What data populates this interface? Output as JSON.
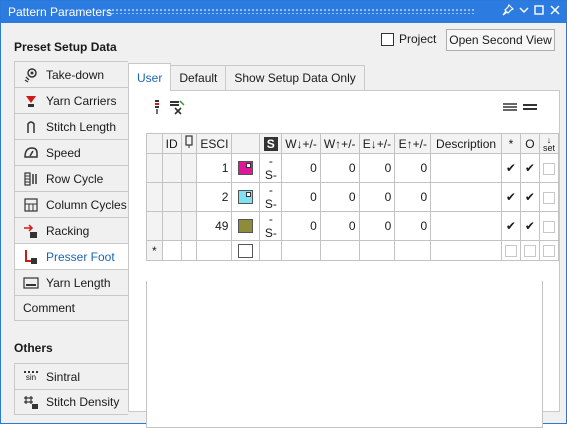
{
  "window": {
    "title": "Pattern Parameters"
  },
  "header": {
    "project_label": "Project",
    "open_second_view_label": "Open Second View"
  },
  "sidebar": {
    "preset_title": "Preset Setup Data",
    "items": [
      {
        "label": "Take-down",
        "icon": "take-down-icon"
      },
      {
        "label": "Yarn Carriers",
        "icon": "yarn-carriers-icon"
      },
      {
        "label": "Stitch Length",
        "icon": "stitch-length-icon"
      },
      {
        "label": "Speed",
        "icon": "speed-icon"
      },
      {
        "label": "Row Cycle",
        "icon": "row-cycle-icon"
      },
      {
        "label": "Column Cycles",
        "icon": "column-cycles-icon"
      },
      {
        "label": "Racking",
        "icon": "racking-icon"
      },
      {
        "label": "Presser Foot",
        "icon": "presser-foot-icon",
        "active": true
      },
      {
        "label": "Yarn Length",
        "icon": "yarn-length-icon"
      },
      {
        "label": "Comment"
      }
    ],
    "others_title": "Others",
    "others": [
      {
        "label": "Sintral",
        "icon": "sintral-icon",
        "icon_text": "sin"
      },
      {
        "label": "Stitch Density",
        "icon": "stitch-density-icon"
      }
    ]
  },
  "tabs": [
    {
      "label": "User",
      "active": true
    },
    {
      "label": "Default"
    },
    {
      "label": "Show Setup Data Only"
    }
  ],
  "grid": {
    "headers": [
      "ID",
      "ESCI",
      "W↓+/-",
      "W↑+/-",
      "E↓+/-",
      "E↑+/-",
      "Description",
      "*",
      "O",
      "set"
    ],
    "rows": [
      {
        "esci": "1",
        "color": "#e0179a",
        "w_down": "0",
        "w_up": "0",
        "e_down": "0",
        "e_up": "0",
        "star": "✔",
        "o": "✔"
      },
      {
        "esci": "2",
        "color": "#7fe0f2",
        "w_down": "0",
        "w_up": "0",
        "e_down": "0",
        "e_up": "0",
        "star": "✔",
        "o": "✔"
      },
      {
        "esci": "49",
        "color": "#8c8c3a",
        "w_down": "0",
        "w_up": "0",
        "e_down": "0",
        "e_up": "0",
        "star": "✔",
        "o": "✔"
      }
    ],
    "new_row_marker": "*"
  },
  "colors": {
    "accent": "#2c7be0",
    "link": "#1c63b8"
  }
}
